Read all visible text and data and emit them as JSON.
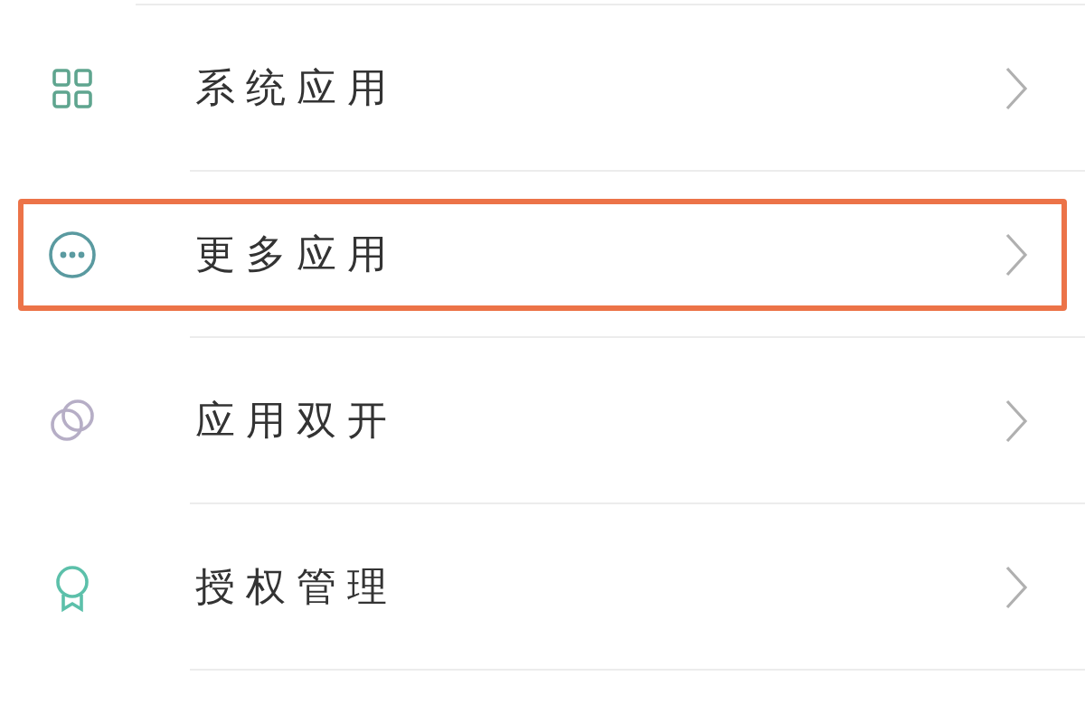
{
  "items": [
    {
      "label": "系统应用",
      "kind": "grid",
      "highlighted": false
    },
    {
      "label": "更多应用",
      "kind": "more",
      "highlighted": true
    },
    {
      "label": "应用双开",
      "kind": "dual",
      "highlighted": false
    },
    {
      "label": "授权管理",
      "kind": "award",
      "highlighted": false
    }
  ]
}
